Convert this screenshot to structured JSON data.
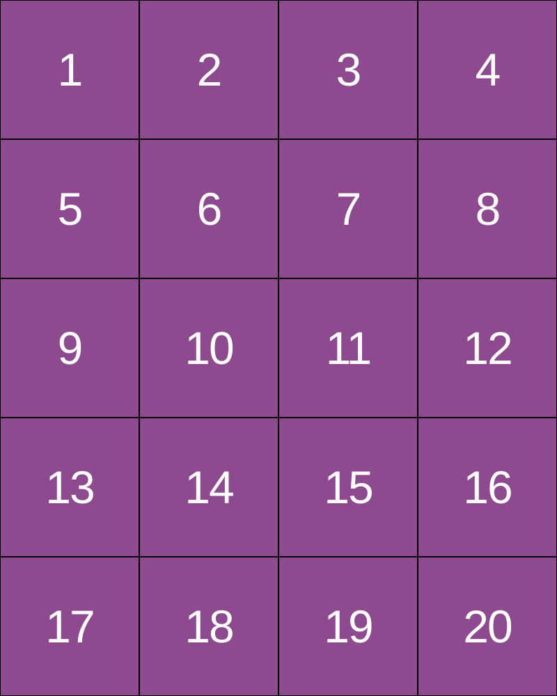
{
  "board": {
    "rows": 5,
    "columns": 4,
    "colors": {
      "tile": "#8E4A8F",
      "number": "#FFFFFF",
      "border": "#000000"
    },
    "tiles": [
      "1",
      "2",
      "3",
      "4",
      "5",
      "6",
      "7",
      "8",
      "9",
      "10",
      "11",
      "12",
      "13",
      "14",
      "15",
      "16",
      "17",
      "18",
      "19",
      "20"
    ]
  }
}
